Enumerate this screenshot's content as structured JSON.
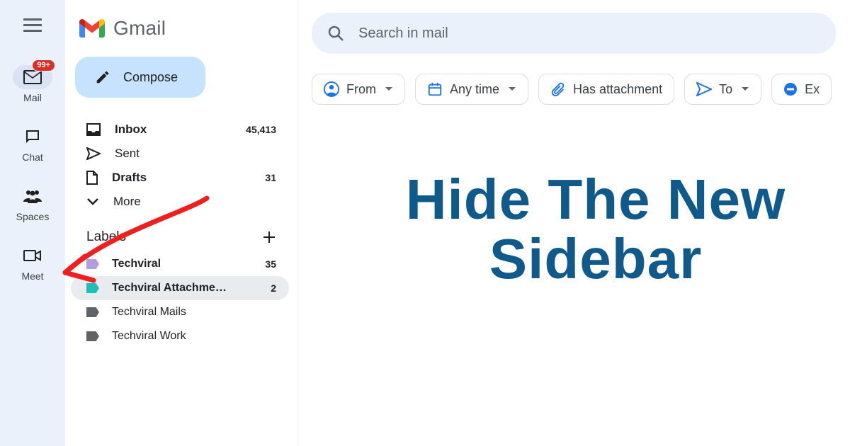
{
  "brand": {
    "name": "Gmail"
  },
  "search": {
    "placeholder": "Search in mail"
  },
  "rail": {
    "items": [
      {
        "label": "Mail",
        "badge": "99+"
      },
      {
        "label": "Chat"
      },
      {
        "label": "Spaces"
      },
      {
        "label": "Meet"
      }
    ]
  },
  "compose": {
    "label": "Compose"
  },
  "folders": [
    {
      "label": "Inbox",
      "count": "45,413",
      "bold": true
    },
    {
      "label": "Sent"
    },
    {
      "label": "Drafts",
      "count": "31",
      "bold": true
    },
    {
      "label": "More"
    }
  ],
  "labels_section": {
    "title": "Labels"
  },
  "labels": [
    {
      "name": "Techviral",
      "count": "35",
      "color": "#b39ddb",
      "bold": true
    },
    {
      "name": "Techviral Attachme…",
      "count": "2",
      "color": "#1fbfb8",
      "bold": true,
      "selected": true
    },
    {
      "name": "Techviral Mails",
      "color": "#5f6368"
    },
    {
      "name": "Techviral Work",
      "color": "#5f6368"
    }
  ],
  "chips": [
    {
      "label": "From",
      "icon": "person",
      "caret": true
    },
    {
      "label": "Any time",
      "icon": "calendar",
      "caret": true
    },
    {
      "label": "Has attachment",
      "icon": "clip",
      "caret": false
    },
    {
      "label": "To",
      "icon": "send",
      "caret": true
    },
    {
      "label": "Ex",
      "icon": "minus",
      "caret": false
    }
  ],
  "hero": {
    "line1": "Hide The New",
    "line2": "Sidebar"
  },
  "colors": {
    "rail_bg": "#eaf1fb",
    "compose_bg": "#c6e2ff",
    "badge_bg": "#d93025",
    "hero_text": "#0f5a8a",
    "arrow": "#ef1f1f"
  }
}
